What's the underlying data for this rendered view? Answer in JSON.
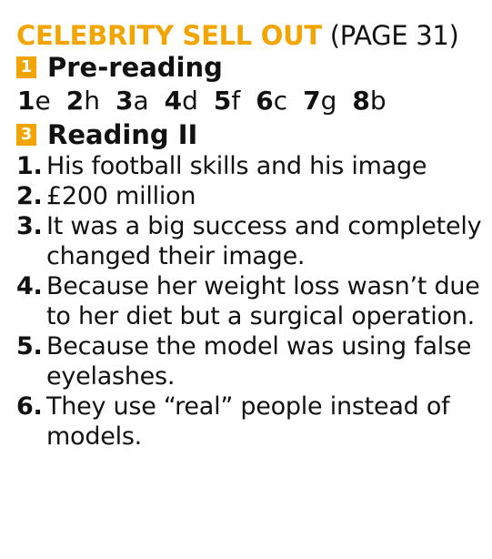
{
  "title": {
    "main": "CELEBRITY SELL OUT",
    "page_ref": "(PAGE 31)"
  },
  "sections": [
    {
      "number": "1",
      "heading": "Pre-reading"
    },
    {
      "number": "3",
      "heading": "Reading II"
    }
  ],
  "pre_reading_answers": [
    {
      "num": "1",
      "letter": "e"
    },
    {
      "num": "2",
      "letter": "h"
    },
    {
      "num": "3",
      "letter": "a"
    },
    {
      "num": "4",
      "letter": "d"
    },
    {
      "num": "5",
      "letter": "f"
    },
    {
      "num": "6",
      "letter": "c"
    },
    {
      "num": "7",
      "letter": "g"
    },
    {
      "num": "8",
      "letter": "b"
    }
  ],
  "reading_answers": [
    {
      "num": "1.",
      "text": "His football skills and his image"
    },
    {
      "num": "2.",
      "text": "£200 million"
    },
    {
      "num": "3.",
      "text": "It was a big success and completely changed their image."
    },
    {
      "num": "4.",
      "text": "Because her weight loss wasn’t due to her diet but a surgical operation."
    },
    {
      "num": "5.",
      "text": "Because the model was using false eyelashes."
    },
    {
      "num": "6.",
      "text": "They use “real” people instead of models."
    }
  ],
  "colors": {
    "accent": "#f2a400",
    "text": "#111111"
  }
}
